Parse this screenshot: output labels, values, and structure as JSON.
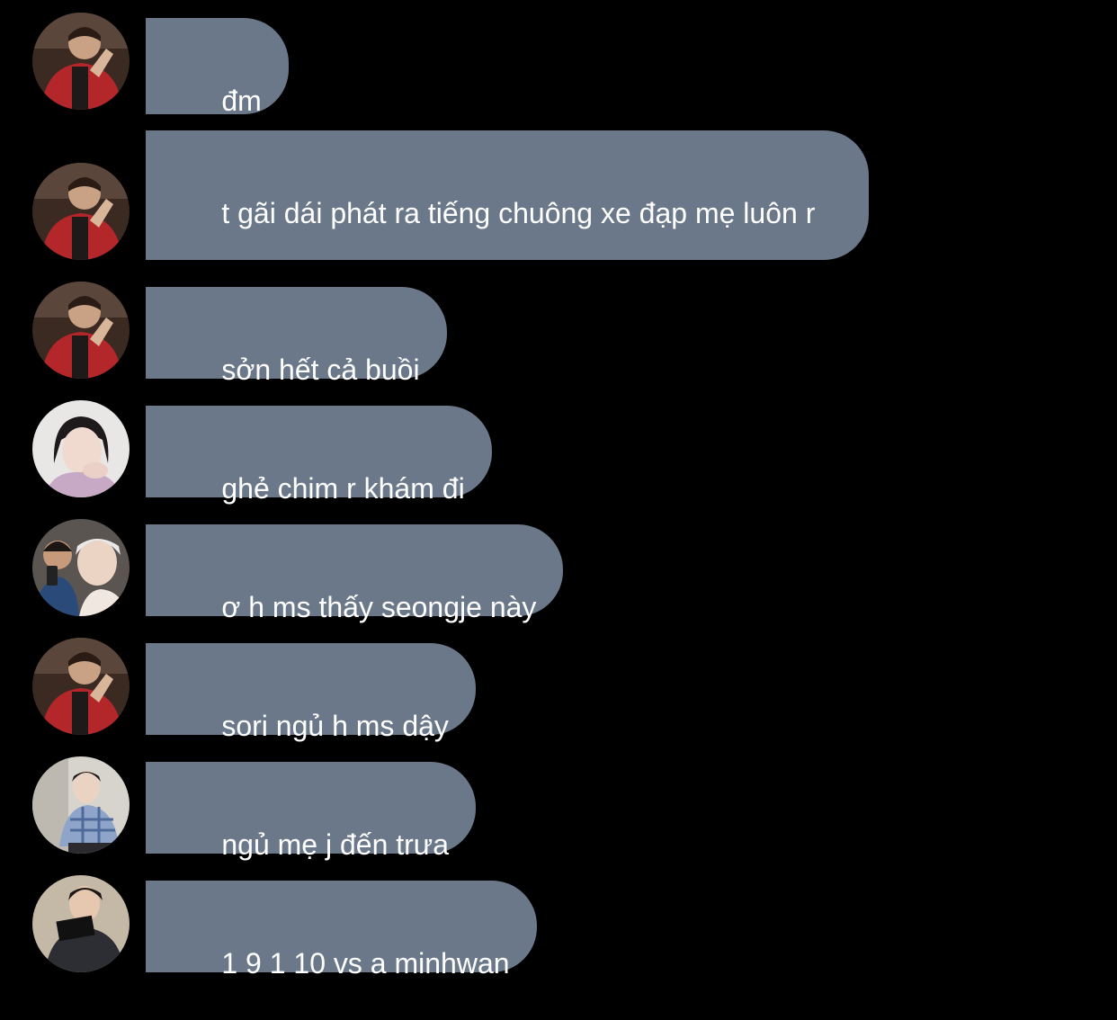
{
  "colors": {
    "background": "#000000",
    "bubble": "#6b7889",
    "text": "#ffffff"
  },
  "messages": [
    {
      "text": "đm",
      "avatar": "avatar-boy-red-jacket"
    },
    {
      "text": "t gãi dái phát ra tiếng chuông xe đạp mẹ luôn r",
      "avatar": "avatar-boy-red-jacket"
    },
    {
      "text": "sởn hết cả buồi",
      "avatar": "avatar-boy-red-jacket"
    },
    {
      "text": "ghẻ chim r khám đi",
      "avatar": "avatar-girl-white"
    },
    {
      "text": "ơ h ms thấy seongje này",
      "avatar": "avatar-two-boys-selfie"
    },
    {
      "text": "sori ngủ h ms dậy",
      "avatar": "avatar-boy-red-jacket"
    },
    {
      "text": "ngủ mẹ j đến trưa",
      "avatar": "avatar-boy-plaid-shirt"
    },
    {
      "text": "1 9 1 10 vs a minhwan",
      "avatar": "avatar-boy-sign"
    }
  ]
}
